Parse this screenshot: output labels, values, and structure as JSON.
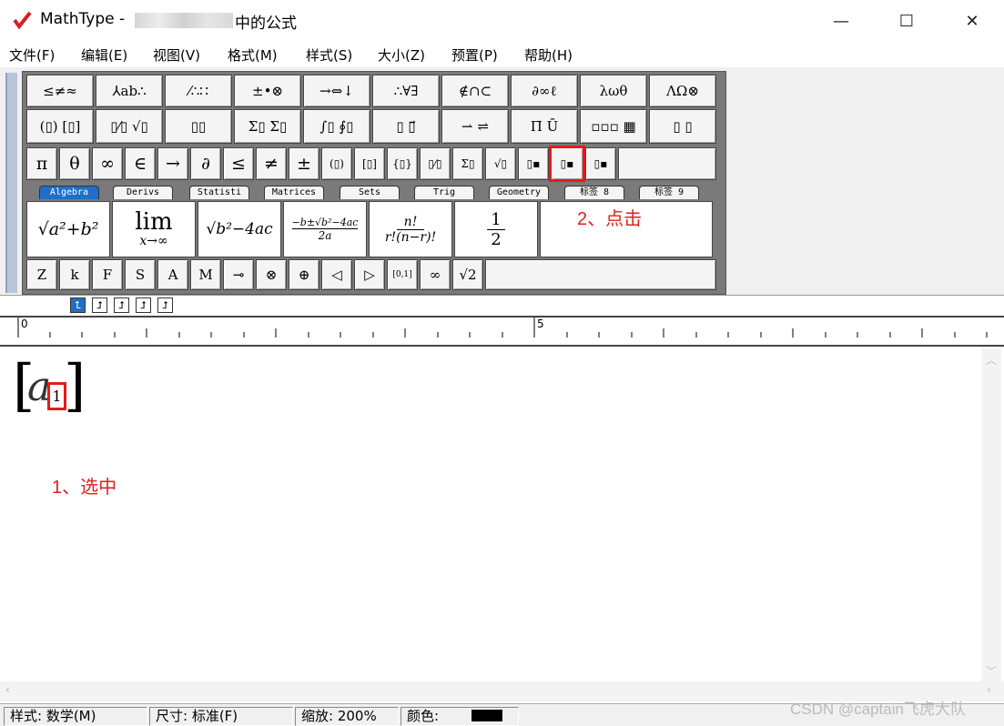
{
  "window": {
    "app_name": "MathType - ",
    "title_suffix": "中的公式",
    "minimize": "—",
    "maximize": "☐",
    "close": "✕"
  },
  "menu": [
    "文件(F)",
    "编辑(E)",
    "视图(V)",
    "格式(M)",
    "样式(S)",
    "大小(Z)",
    "预置(P)",
    "帮助(H)"
  ],
  "palette": {
    "row1": [
      "≤≠≈",
      "⅄ab∴",
      "⁄∴∷",
      "±•⊗",
      "→⇔↓",
      "∴∀∃",
      "∉∩⊂",
      "∂∞ℓ",
      "λωθ",
      "ΛΩ⊗"
    ],
    "row2": [
      "(▯) [▯]",
      "▯⁄▯ √▯",
      "▯▯",
      "Σ▯ Σ▯",
      "∫▯ ∮▯",
      "▯ ▯⃗",
      "⇀ ⇌",
      "Π̄ Ū",
      "▫▫▫ ▦",
      "▯ ▯"
    ],
    "row3": [
      "π",
      "θ",
      "∞",
      "∈",
      "→",
      "∂",
      "≤",
      "≠",
      "±",
      "(▯)",
      "[▯]",
      "{▯}",
      "▯⁄▯",
      "Σ▯",
      "√▯",
      "▯▪",
      "▯▪",
      "▯▪"
    ],
    "tabs": [
      "Algebra",
      "Derivs",
      "Statisti",
      "Matrices",
      "Sets",
      "Trig",
      "Geometry",
      "标签 8",
      "标签 9"
    ],
    "templates": [
      "√a²+b²",
      "lim",
      "x→∞",
      "√b²−4ac",
      "−b±√b²−4ac",
      "2a",
      "n!",
      "r!(n−r)!",
      "1",
      "2"
    ],
    "row5": [
      "Z",
      "k",
      "F",
      "S",
      "A",
      "M",
      "⊸",
      "⊗",
      "⊕",
      "◁",
      "▷",
      "[0,1]",
      "∞",
      "√2"
    ]
  },
  "annotations": {
    "click": "2、点击",
    "select": "1、选中"
  },
  "nudge": [
    "⮤",
    "⮥",
    "⮥",
    "⮥",
    "⮥"
  ],
  "ruler": {
    "mark0": "0",
    "mark5": "5"
  },
  "editor": {
    "open_bracket": "[",
    "variable": "a",
    "subscript": "1",
    "close_bracket": "]"
  },
  "status": {
    "style": "样式: 数学(M)",
    "size": "尺寸: 标准(F)",
    "zoom": "缩放: 200%",
    "color": "颜色:"
  },
  "colors": {
    "accent": "#1e6fc9",
    "highlight": "#e51b1b",
    "annotation": "#e02020"
  },
  "watermark": "CSDN @captain飞虎大队"
}
